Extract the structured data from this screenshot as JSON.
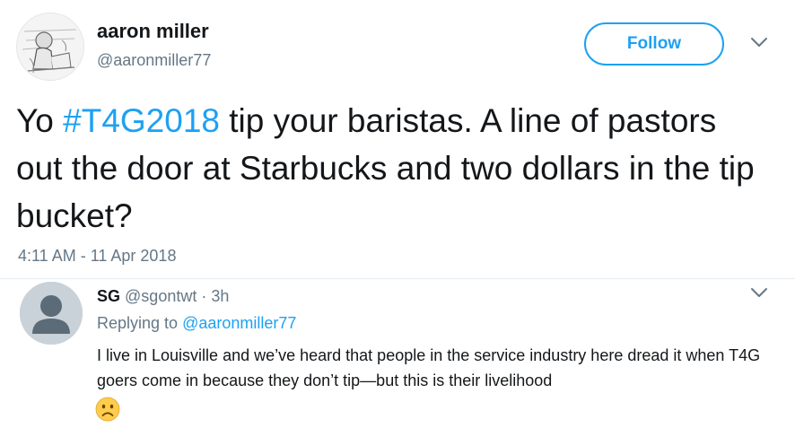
{
  "author": {
    "name": "aaron miller",
    "handle": "@aaronmiller77",
    "avatar_icon": "sketch-avatar"
  },
  "actions": {
    "follow_label": "Follow",
    "menu_icon": "chevron-down-icon"
  },
  "tweet": {
    "text_before": "Yo ",
    "hashtag": "#T4G2018",
    "text_after": " tip your baristas. A line of pastors out the door at Starbucks and two dollars in the tip bucket?",
    "timestamp": "4:11 AM - 11 Apr 2018"
  },
  "reply": {
    "name": "SG",
    "handle": "@sgontwt",
    "separator": "·",
    "time": "3h",
    "replying_prefix": "Replying to ",
    "replying_to": "@aaronmiller77",
    "text": "I live in Louisville and we’ve heard that people in the service industry here dread it when T4G goers come in because they don’t tip—but this is their livelihood",
    "emoji_icon": "slightly-frowning-face-icon",
    "menu_icon": "chevron-down-icon"
  },
  "colors": {
    "accent": "#1da1f2",
    "muted": "#657786",
    "text": "#14171a",
    "divider": "#e6ecf0"
  }
}
